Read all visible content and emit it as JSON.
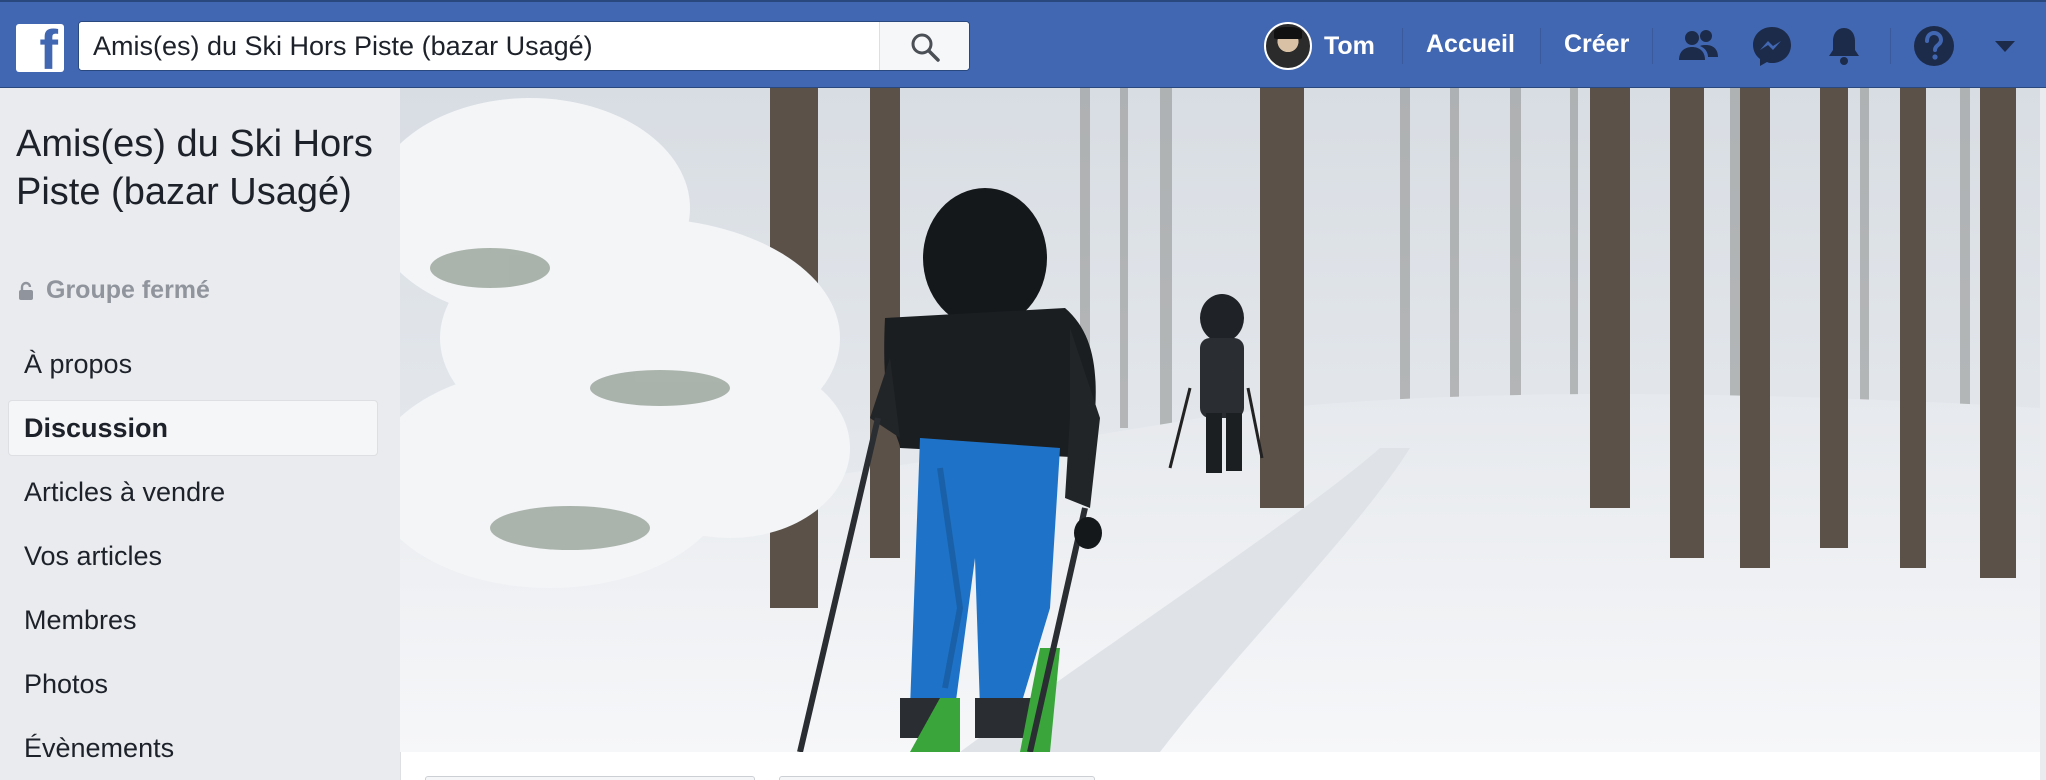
{
  "header": {
    "logo_letter": "f",
    "search": {
      "value": "Amis(es) du Ski Hors Piste (bazar Usagé)"
    },
    "user_name": "Tom",
    "nav": {
      "home": "Accueil",
      "create": "Créer"
    }
  },
  "group": {
    "title": "Amis(es) du Ski Hors Piste (bazar Usagé)",
    "privacy": "Groupe fermé"
  },
  "menu": [
    {
      "label": "À propos",
      "active": false
    },
    {
      "label": "Discussion",
      "active": true
    },
    {
      "label": "Articles à vendre",
      "active": false
    },
    {
      "label": "Vos articles",
      "active": false
    },
    {
      "label": "Membres",
      "active": false
    },
    {
      "label": "Photos",
      "active": false
    },
    {
      "label": "Évènements",
      "active": false
    }
  ],
  "icons": [
    "facebook-logo-icon",
    "search-icon",
    "friends-icon",
    "messenger-icon",
    "notifications-bell-icon",
    "help-icon",
    "caret-down-icon",
    "lock-icon"
  ],
  "colors": {
    "brand": "#4267b2",
    "page_bg": "#e9ebee",
    "snow": "#eef1f4",
    "ski_pants": "#1e73c8",
    "skis": "#3aa53a"
  }
}
